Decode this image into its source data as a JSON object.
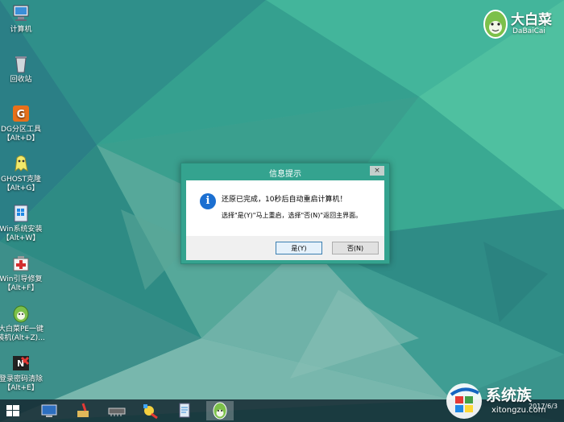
{
  "desktop": {
    "icons": [
      {
        "label": "计算机"
      },
      {
        "label": "回收站"
      },
      {
        "label": "DG分区工具\n【Alt+D】"
      },
      {
        "label": "GHOST克隆\n【Alt+G】"
      },
      {
        "label": "Win系统安装\n【Alt+W】"
      },
      {
        "label": "Win引导修复\n【Alt+F】"
      },
      {
        "label": "大白菜PE一键\n装机(Alt+Z)..."
      },
      {
        "label": "登录密码清除\n【Alt+E】"
      }
    ]
  },
  "logo": {
    "title": "大白菜",
    "subtitle": "DaBaiCai"
  },
  "dialog": {
    "title": "信息提示",
    "close_label": "×",
    "info_glyph": "i",
    "message_line1": "还原已完成，10秒后自动重启计算机！",
    "message_line2": "选择\"是(Y)\"马上重启，选择\"否(N)\"返回主界面。",
    "yes_label": "是(Y)",
    "no_label": "否(N)"
  },
  "taskbar": {
    "clock_time": "",
    "clock_date": "2017/6/3"
  },
  "watermark": {
    "brand": "系统族",
    "url": "xitongzu.com"
  },
  "colors": {
    "accent": "#34a38f",
    "taskbar": "#142830",
    "info_blue": "#1b6fd1"
  }
}
